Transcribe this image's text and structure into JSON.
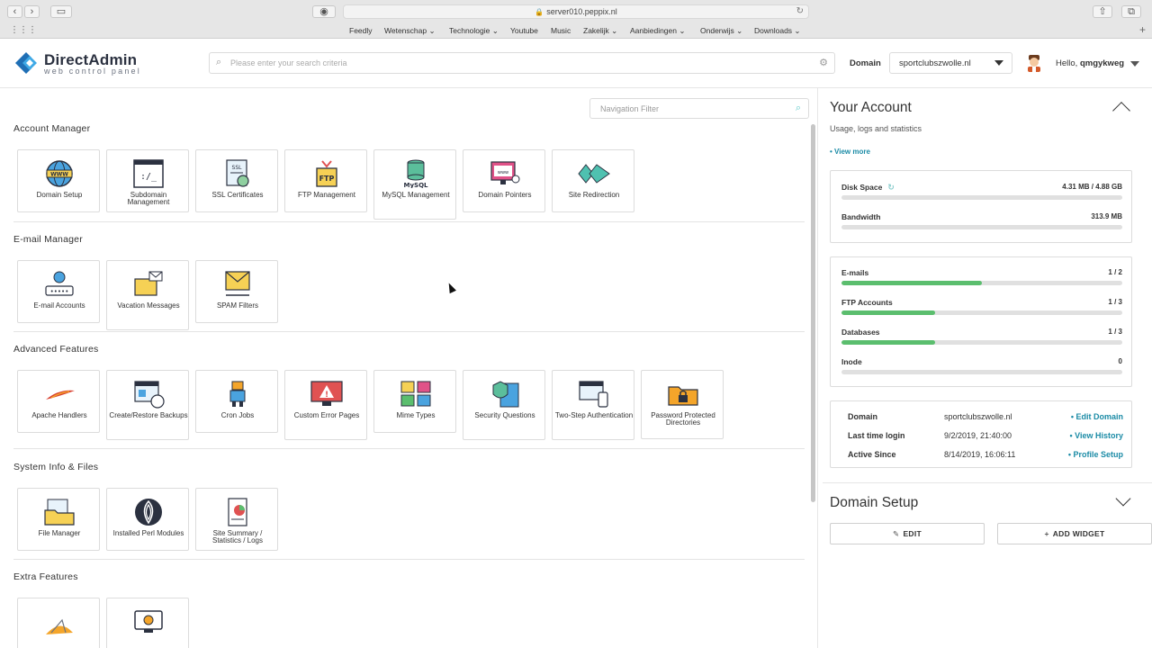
{
  "browser": {
    "url": "server010.peppix.nl",
    "bookmarks": [
      "Feedly",
      "Wetenschap ⌄",
      "Technologie ⌄",
      "Youtube",
      "Music",
      "Zakelijk ⌄",
      "Aanbiedingen ⌄",
      "Onderwijs ⌄",
      "Downloads ⌄"
    ]
  },
  "header": {
    "logo_name": "DirectAdmin",
    "logo_sub": "web control panel",
    "search_placeholder": "Please enter your search criteria",
    "domain_label": "Domain",
    "domain_value": "sportclubszwolle.nl",
    "hello_prefix": "Hello,",
    "username": "qmgykweg"
  },
  "main": {
    "nav_filter_placeholder": "Navigation Filter",
    "sections": [
      {
        "title": "Account Manager",
        "items": [
          {
            "label": "Domain Setup",
            "icon": "globe-www-icon"
          },
          {
            "label": "Subdomain Management",
            "icon": "terminal-icon"
          },
          {
            "label": "SSL Certificates",
            "icon": "ssl-certificate-icon"
          },
          {
            "label": "FTP Management",
            "icon": "ftp-folder-icon"
          },
          {
            "label": "MySQL Management",
            "icon": "mysql-database-icon"
          },
          {
            "label": "Domain Pointers",
            "icon": "domain-pointer-icon"
          },
          {
            "label": "Site Redirection",
            "icon": "redirect-arrows-icon"
          }
        ]
      },
      {
        "title": "E-mail Manager",
        "items": [
          {
            "label": "E-mail Accounts",
            "icon": "email-account-icon"
          },
          {
            "label": "Vacation Messages",
            "icon": "vacation-mail-icon"
          },
          {
            "label": "SPAM Filters",
            "icon": "spam-filter-icon"
          }
        ]
      },
      {
        "title": "Advanced Features",
        "items": [
          {
            "label": "Apache Handlers",
            "icon": "apache-feather-icon"
          },
          {
            "label": "Create/Restore Backups",
            "icon": "backup-icon"
          },
          {
            "label": "Cron Jobs",
            "icon": "robot-icon"
          },
          {
            "label": "Custom Error Pages",
            "icon": "error-monitor-icon"
          },
          {
            "label": "Mime Types",
            "icon": "mime-types-icon"
          },
          {
            "label": "Security Questions",
            "icon": "security-shield-icon"
          },
          {
            "label": "Two-Step Authentication",
            "icon": "two-step-auth-icon"
          },
          {
            "label": "Password Protected Directories",
            "icon": "locked-folder-icon"
          }
        ]
      },
      {
        "title": "System Info & Files",
        "items": [
          {
            "label": "File Manager",
            "icon": "file-manager-icon"
          },
          {
            "label": "Installed Perl Modules",
            "icon": "perl-onion-icon"
          },
          {
            "label": "Site Summary / Statistics / Logs",
            "icon": "statistics-report-icon"
          }
        ]
      },
      {
        "title": "Extra Features",
        "items": [
          {
            "label": "",
            "icon": "phpmyadmin-icon"
          },
          {
            "label": "",
            "icon": "monitor-gear-icon"
          }
        ]
      }
    ]
  },
  "account": {
    "title": "Your Account",
    "subtitle": "Usage, logs and statistics",
    "view_more": "• View more",
    "usage": [
      {
        "label": "Disk Space",
        "value": "4.31 MB / 4.88 GB",
        "fraction": 0.0
      },
      {
        "label": "Bandwidth",
        "value": "313.9 MB",
        "fraction": 0.0
      }
    ],
    "counts": [
      {
        "label": "E-mails",
        "value": "1 / 2",
        "fraction": 0.5
      },
      {
        "label": "FTP Accounts",
        "value": "1 / 3",
        "fraction": 0.333
      },
      {
        "label": "Databases",
        "value": "1 / 3",
        "fraction": 0.333
      },
      {
        "label": "Inode",
        "value": "0",
        "fraction": 0.0
      }
    ],
    "info": [
      {
        "key": "Domain",
        "value": "sportclubszwolle.nl",
        "link": "• Edit Domain"
      },
      {
        "key": "Last time login",
        "value": "9/2/2019, 21:40:00",
        "link": "• View History"
      },
      {
        "key": "Active Since",
        "value": "8/14/2019, 16:06:11",
        "link": "• Profile Setup"
      }
    ]
  },
  "domain_setup": {
    "title": "Domain Setup",
    "edit_label": "EDIT",
    "add_widget_label": "ADD WIDGET"
  },
  "colors": {
    "accent": "#1b8ba6",
    "progress": "#5bbe6e",
    "logo_blue": "#2a8fd6"
  }
}
